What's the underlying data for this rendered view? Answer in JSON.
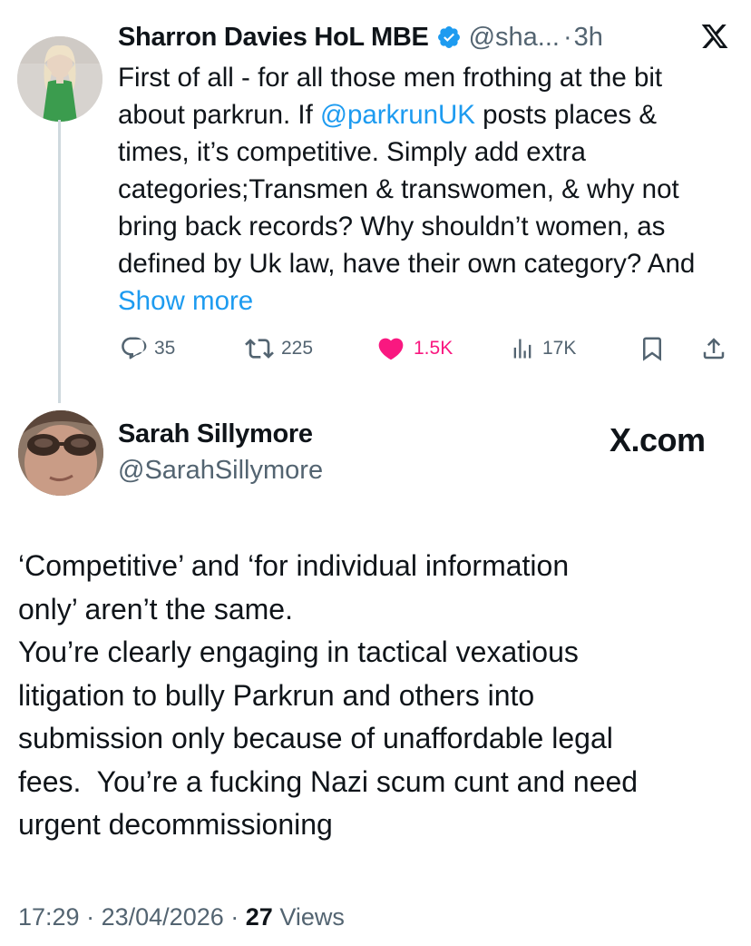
{
  "original_tweet": {
    "author_name": "Sharron Davies HoL MBE",
    "verified": true,
    "handle": "@sha...",
    "separator": "·",
    "time": "3h",
    "text_before_mention": "First of all - for all those men frothing at the bit about parkrun. If ",
    "mention": "@parkrunUK",
    "text_after_mention": " posts places & times, it’s competitive. Simply add extra categories;Transmen & transwomen, & why not bring back records? Why shouldn’t women, as defined by Uk law, have their own category? And ",
    "show_more_label": "Show more",
    "stats": {
      "replies": "35",
      "reposts": "225",
      "likes": "1.5K",
      "views": "17K"
    }
  },
  "reply": {
    "author_name": "Sarah Sillymore",
    "handle": "@SarahSillymore",
    "brand_label": "X.com",
    "text_lines": [
      "‘Competitive’ and ‘for individual information",
      "only’ aren’t the same.",
      "You’re clearly engaging in tactical vexatious",
      "litigation to bully Parkrun and others into",
      "submission only because of unaffordable legal",
      "fees.  You’re a fucking Nazi scum cunt and need",
      "urgent decommissioning"
    ],
    "timestamp": "17:29",
    "date": "23/04/2026",
    "separator": "·",
    "views_count": "27",
    "views_label": "Views"
  },
  "colors": {
    "link_blue": "#1d9bf0",
    "like_pink": "#f91880",
    "secondary_gray": "#536471",
    "verified_blue": "#1d9bf0"
  },
  "icons": [
    "x-logo-icon",
    "verified-badge-icon",
    "reply-icon",
    "repost-icon",
    "like-icon",
    "views-icon",
    "bookmark-icon",
    "share-icon"
  ]
}
